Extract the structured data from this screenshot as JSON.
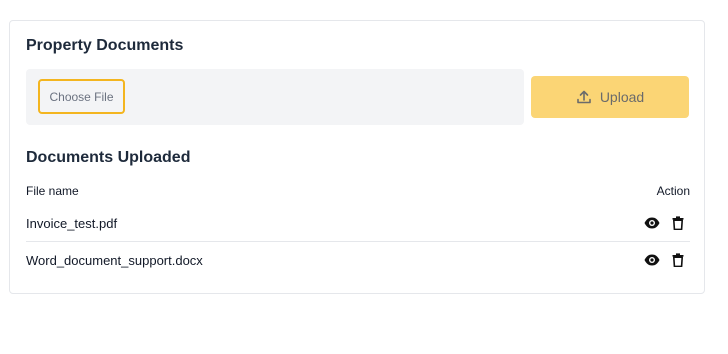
{
  "section": {
    "title": "Property Documents",
    "choose_file_label": "Choose File",
    "upload_label": "Upload"
  },
  "uploaded": {
    "title": "Documents Uploaded",
    "columns": {
      "file_name": "File name",
      "action": "Action"
    },
    "rows": [
      {
        "file_name": "Invoice_test.pdf"
      },
      {
        "file_name": "Word_document_support.docx"
      }
    ]
  },
  "icons": {
    "upload": "upload-icon",
    "view": "eye-icon",
    "delete": "trash-icon"
  },
  "colors": {
    "accent_border": "#f3b51f",
    "upload_button": "#fbd575",
    "file_area": "#f3f4f6",
    "title": "#1e2a3b"
  }
}
